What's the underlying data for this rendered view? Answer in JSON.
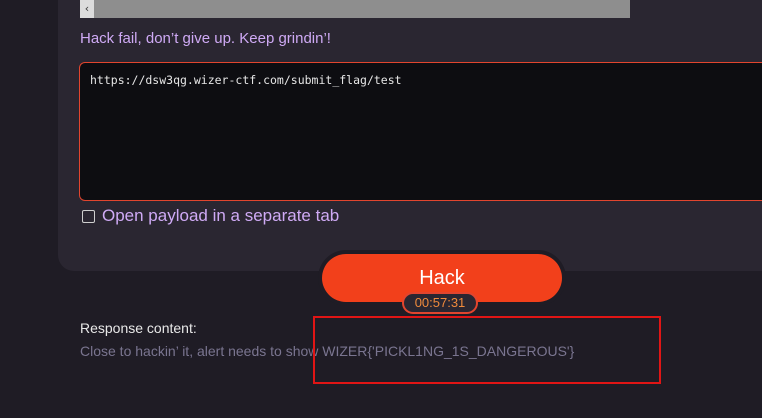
{
  "scrollbar": {
    "left_arrow": "‹"
  },
  "result": {
    "message": "Hack fail, don’t give up. Keep grindin’!"
  },
  "payload": {
    "value": "https://dsw3qg.wizer-ctf.com/submit_flag/test"
  },
  "options": {
    "separate_tab_label": "Open payload in a separate tab",
    "separate_tab_checked": false
  },
  "actions": {
    "hack_label": "Hack",
    "timer": "00:57:31"
  },
  "response": {
    "label": "Response content:",
    "content": "Close to hackin’ it, alert needs to show WIZER{'PICKL1NG_1S_DANGEROUS'}"
  },
  "colors": {
    "background": "#1f1c25",
    "panel": "#2a2631",
    "accent": "#f2401b",
    "label_purple": "#cfaaf5",
    "highlight_red": "#e01515"
  }
}
